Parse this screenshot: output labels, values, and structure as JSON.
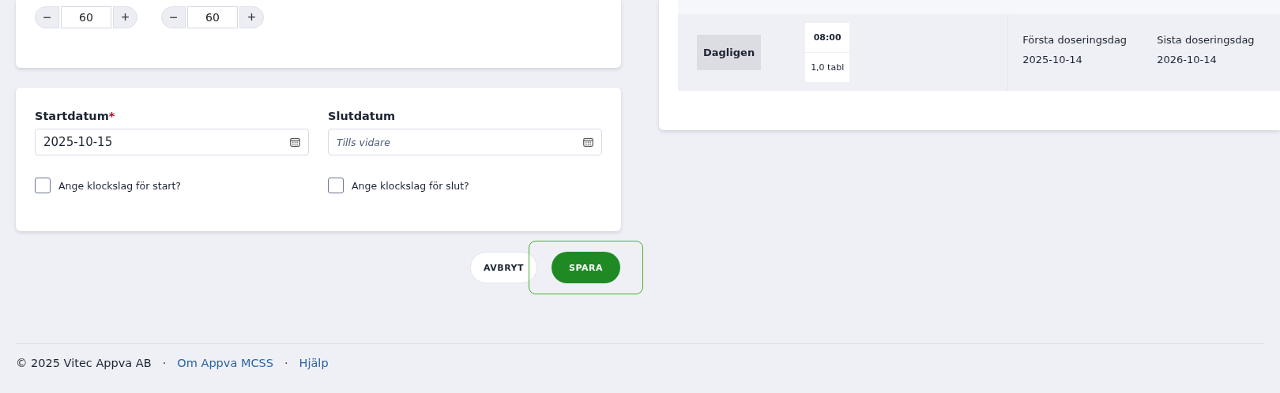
{
  "steppers": [
    {
      "value": "60",
      "minus": "−",
      "plus": "+"
    },
    {
      "value": "60",
      "minus": "−",
      "plus": "+"
    }
  ],
  "dates": [
    {
      "label": "Startdatum",
      "required": true,
      "value": "2025-10-15",
      "checkbox": {
        "label": "Ange klockslag för start?",
        "checked": false
      }
    },
    {
      "label": "Slutdatum",
      "required": false,
      "placeholder": "Tills vidare",
      "checkbox": {
        "label": "Ange klockslag för slut?",
        "checked": false
      }
    }
  ],
  "required_mark": "*",
  "buttons": [
    {
      "label": "AVBRYT",
      "kind": "secondary",
      "focused": false
    },
    {
      "label": "SPARA",
      "kind": "primary",
      "focused": true
    }
  ],
  "dosage": {
    "frequency": "Dagligen",
    "time": "08:00",
    "amount": "1,0 tabl",
    "first_day_label": "Första doseringsdag",
    "first_day": "2025-10-14",
    "last_day_label": "Sista doseringsdag",
    "last_day": "2026-10-14"
  },
  "footer": {
    "copyright": "© 2025 Vitec Appva AB",
    "separator": "·",
    "links": [
      "Om Appva MCSS",
      "Hjälp"
    ]
  }
}
